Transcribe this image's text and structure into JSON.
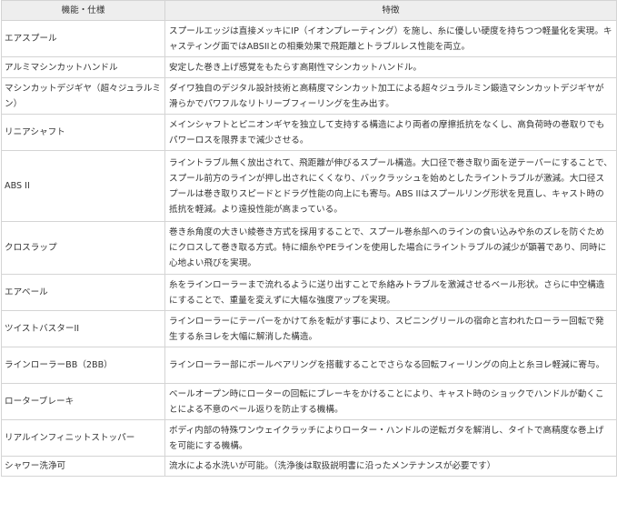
{
  "table": {
    "headers": [
      "機能・仕様",
      "特徴"
    ],
    "rows": [
      {
        "feature": "エアスプール",
        "description": "スプールエッジは直接メッキにIP（イオンプレーティング）を施し、糸に優しい硬度を持ちつつ軽量化を実現。キャスティング面ではABSIIとの相乗効果で飛距離とトラブルレス性能を両立。"
      },
      {
        "feature": "アルミマシンカットハンドル",
        "description": "安定した巻き上げ感覚をもたらす高剛性マシンカットハンドル。"
      },
      {
        "feature": "マシンカットデジギヤ（超々ジュラルミン）",
        "description": "ダイワ独自のデジタル設計技術と高精度マシンカット加工による超々ジュラルミン鍛造マシンカットデジギヤが滑らかでパワフルなリトリーブフィーリングを生み出す。"
      },
      {
        "feature": "リニアシャフト",
        "description": "メインシャフトとピニオンギヤを独立して支持する構造により両者の摩擦抵抗をなくし、高負荷時の巻取りでもパワーロスを限界まで減少させる。"
      },
      {
        "feature": "ABS II",
        "description": "ライントラブル無く放出されて、飛距離が伸びるスプール構造。大口径で巻き取り面を逆テーパーにすることで、スプール前方のラインが押し出されにくくなり、バックラッシュを始めとしたライントラブルが激減。大口径スプールは巻き取りスピードとドラグ性能の向上にも寄与。ABS IIはスプールリング形状を見直し、キャスト時の抵抗を軽減。より遠投性能が高まっている。"
      },
      {
        "feature": "クロスラップ",
        "description": "巻き糸角度の大きい綾巻き方式を採用することで、スプール巻糸部へのラインの食い込みや糸のズレを防ぐためにクロスして巻き取る方式。特に細糸やPEラインを使用した場合にライントラブルの減少が顕著であり、同時に心地よい飛びを実現。"
      },
      {
        "feature": "エアベール",
        "description": "糸をラインローラーまで流れるように送り出すことで糸絡みトラブルを激減させるベール形状。さらに中空構造にすることで、重量を変えずに大幅な強度アップを実現。"
      },
      {
        "feature": "ツイストバスターII",
        "description": "ラインローラーにテーパーをかけて糸を転がす事により、スピニングリールの宿命と言われたローラー回転で発生する糸ヨレを大幅に解消した構造。"
      },
      {
        "feature": "ラインローラーBB（2BB）",
        "description": "ラインローラー部にボールベアリングを搭載することでさらなる回転フィーリングの向上と糸ヨレ軽減に寄与。"
      },
      {
        "feature": "ローターブレーキ",
        "description": "ベールオープン時にローターの回転にブレーキをかけることにより、キャスト時のショックでハンドルが動くことによる不意のベール返りを防止する機構。"
      },
      {
        "feature": "リアルインフィニットストッパー",
        "description": "ボディ内部の特殊ワンウェイクラッチによりローター・ハンドルの逆転ガタを解消し、タイトで高精度な巻上げを可能にする機構。"
      },
      {
        "feature": "シャワー洗浄可",
        "description": "流水による水洗いが可能。（洗浄後は取扱説明書に沿ったメンテナンスが必要です）"
      }
    ]
  }
}
